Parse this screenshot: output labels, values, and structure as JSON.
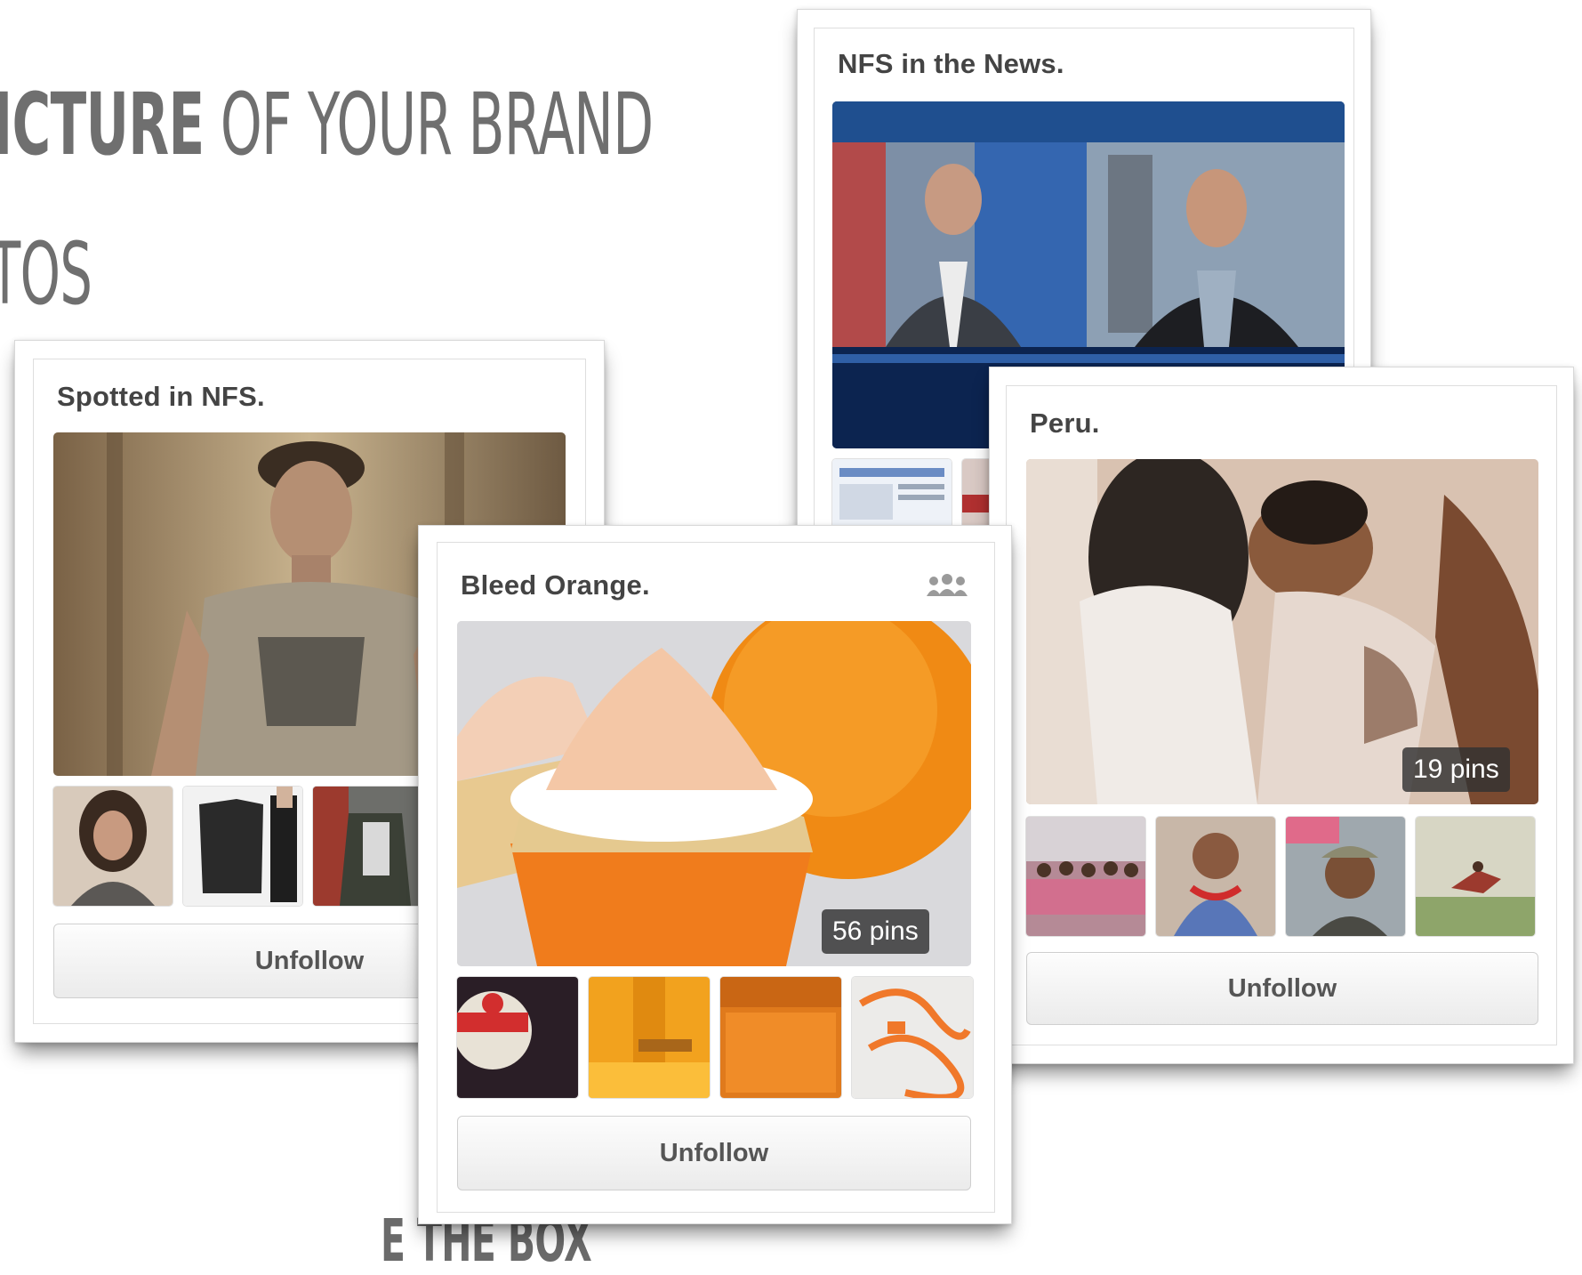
{
  "slide": {
    "heading_line1_strong": "ICTURE",
    "heading_line1_rest": " OF YOUR BRAND",
    "heading_line2": "TOS",
    "heading_bottom": "E THE BOX"
  },
  "boards": [
    {
      "id": "spotted",
      "title": "Spotted in NFS.",
      "button_label": "Unfollow"
    },
    {
      "id": "news",
      "title": "NFS in the News."
    },
    {
      "id": "peru",
      "title": "Peru.",
      "pins_label": "19 pins",
      "button_label": "Unfollow"
    },
    {
      "id": "bleed",
      "title": "Bleed Orange.",
      "pins_label": "56 pins",
      "button_label": "Unfollow",
      "icon": "group-board-icon"
    }
  ]
}
